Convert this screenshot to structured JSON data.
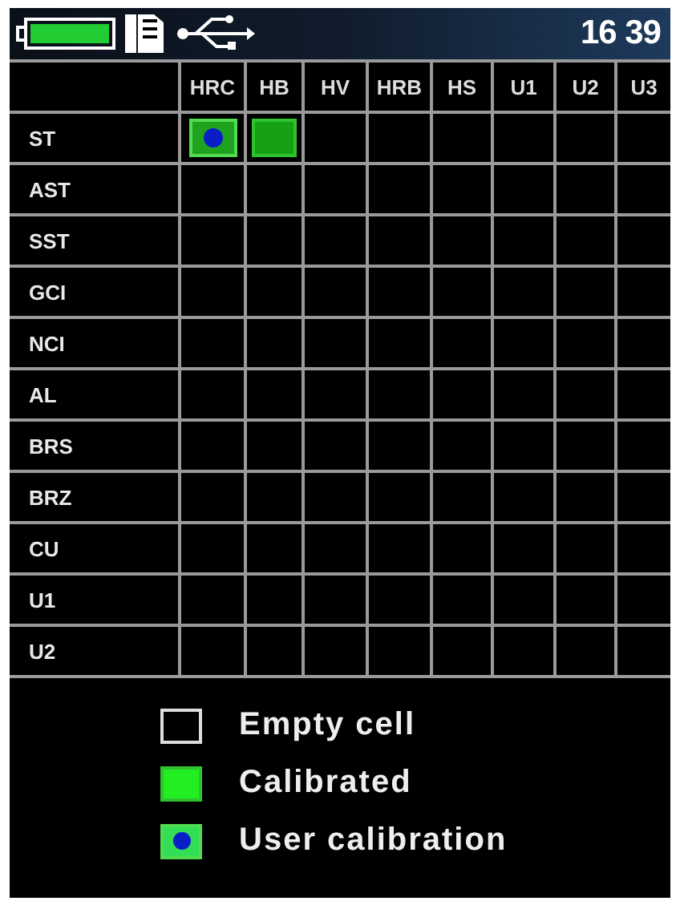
{
  "status_bar": {
    "time": "16 39"
  },
  "table": {
    "columns": [
      "HRC",
      "HB",
      "HV",
      "HRB",
      "HS",
      "U1",
      "U2",
      "U3"
    ],
    "rows": [
      {
        "label": "ST",
        "cells": [
          {
            "calibrated": true,
            "user_calibration": true
          },
          {
            "calibrated": true,
            "user_calibration": false
          },
          {
            "calibrated": false,
            "user_calibration": false
          },
          {
            "calibrated": false,
            "user_calibration": false
          },
          {
            "calibrated": false,
            "user_calibration": false
          },
          {
            "calibrated": false,
            "user_calibration": false
          },
          {
            "calibrated": false,
            "user_calibration": false
          },
          {
            "calibrated": false,
            "user_calibration": false
          }
        ]
      },
      {
        "label": "AST",
        "cells": [
          {
            "calibrated": false,
            "user_calibration": false
          },
          {
            "calibrated": false,
            "user_calibration": false
          },
          {
            "calibrated": false,
            "user_calibration": false
          },
          {
            "calibrated": false,
            "user_calibration": false
          },
          {
            "calibrated": false,
            "user_calibration": false
          },
          {
            "calibrated": false,
            "user_calibration": false
          },
          {
            "calibrated": false,
            "user_calibration": false
          },
          {
            "calibrated": false,
            "user_calibration": false
          }
        ]
      },
      {
        "label": "SST",
        "cells": [
          {
            "calibrated": false,
            "user_calibration": false
          },
          {
            "calibrated": false,
            "user_calibration": false
          },
          {
            "calibrated": false,
            "user_calibration": false
          },
          {
            "calibrated": false,
            "user_calibration": false
          },
          {
            "calibrated": false,
            "user_calibration": false
          },
          {
            "calibrated": false,
            "user_calibration": false
          },
          {
            "calibrated": false,
            "user_calibration": false
          },
          {
            "calibrated": false,
            "user_calibration": false
          }
        ]
      },
      {
        "label": "GCI",
        "cells": [
          {
            "calibrated": false,
            "user_calibration": false
          },
          {
            "calibrated": false,
            "user_calibration": false
          },
          {
            "calibrated": false,
            "user_calibration": false
          },
          {
            "calibrated": false,
            "user_calibration": false
          },
          {
            "calibrated": false,
            "user_calibration": false
          },
          {
            "calibrated": false,
            "user_calibration": false
          },
          {
            "calibrated": false,
            "user_calibration": false
          },
          {
            "calibrated": false,
            "user_calibration": false
          }
        ]
      },
      {
        "label": "NCI",
        "cells": [
          {
            "calibrated": false,
            "user_calibration": false
          },
          {
            "calibrated": false,
            "user_calibration": false
          },
          {
            "calibrated": false,
            "user_calibration": false
          },
          {
            "calibrated": false,
            "user_calibration": false
          },
          {
            "calibrated": false,
            "user_calibration": false
          },
          {
            "calibrated": false,
            "user_calibration": false
          },
          {
            "calibrated": false,
            "user_calibration": false
          },
          {
            "calibrated": false,
            "user_calibration": false
          }
        ]
      },
      {
        "label": "AL",
        "cells": [
          {
            "calibrated": false,
            "user_calibration": false
          },
          {
            "calibrated": false,
            "user_calibration": false
          },
          {
            "calibrated": false,
            "user_calibration": false
          },
          {
            "calibrated": false,
            "user_calibration": false
          },
          {
            "calibrated": false,
            "user_calibration": false
          },
          {
            "calibrated": false,
            "user_calibration": false
          },
          {
            "calibrated": false,
            "user_calibration": false
          },
          {
            "calibrated": false,
            "user_calibration": false
          }
        ]
      },
      {
        "label": "BRS",
        "cells": [
          {
            "calibrated": false,
            "user_calibration": false
          },
          {
            "calibrated": false,
            "user_calibration": false
          },
          {
            "calibrated": false,
            "user_calibration": false
          },
          {
            "calibrated": false,
            "user_calibration": false
          },
          {
            "calibrated": false,
            "user_calibration": false
          },
          {
            "calibrated": false,
            "user_calibration": false
          },
          {
            "calibrated": false,
            "user_calibration": false
          },
          {
            "calibrated": false,
            "user_calibration": false
          }
        ]
      },
      {
        "label": "BRZ",
        "cells": [
          {
            "calibrated": false,
            "user_calibration": false
          },
          {
            "calibrated": false,
            "user_calibration": false
          },
          {
            "calibrated": false,
            "user_calibration": false
          },
          {
            "calibrated": false,
            "user_calibration": false
          },
          {
            "calibrated": false,
            "user_calibration": false
          },
          {
            "calibrated": false,
            "user_calibration": false
          },
          {
            "calibrated": false,
            "user_calibration": false
          },
          {
            "calibrated": false,
            "user_calibration": false
          }
        ]
      },
      {
        "label": "CU",
        "cells": [
          {
            "calibrated": false,
            "user_calibration": false
          },
          {
            "calibrated": false,
            "user_calibration": false
          },
          {
            "calibrated": false,
            "user_calibration": false
          },
          {
            "calibrated": false,
            "user_calibration": false
          },
          {
            "calibrated": false,
            "user_calibration": false
          },
          {
            "calibrated": false,
            "user_calibration": false
          },
          {
            "calibrated": false,
            "user_calibration": false
          },
          {
            "calibrated": false,
            "user_calibration": false
          }
        ]
      },
      {
        "label": "U1",
        "cells": [
          {
            "calibrated": false,
            "user_calibration": false
          },
          {
            "calibrated": false,
            "user_calibration": false
          },
          {
            "calibrated": false,
            "user_calibration": false
          },
          {
            "calibrated": false,
            "user_calibration": false
          },
          {
            "calibrated": false,
            "user_calibration": false
          },
          {
            "calibrated": false,
            "user_calibration": false
          },
          {
            "calibrated": false,
            "user_calibration": false
          },
          {
            "calibrated": false,
            "user_calibration": false
          }
        ]
      },
      {
        "label": "U2",
        "cells": [
          {
            "calibrated": false,
            "user_calibration": false
          },
          {
            "calibrated": false,
            "user_calibration": false
          },
          {
            "calibrated": false,
            "user_calibration": false
          },
          {
            "calibrated": false,
            "user_calibration": false
          },
          {
            "calibrated": false,
            "user_calibration": false
          },
          {
            "calibrated": false,
            "user_calibration": false
          },
          {
            "calibrated": false,
            "user_calibration": false
          },
          {
            "calibrated": false,
            "user_calibration": false
          }
        ]
      }
    ]
  },
  "legend": [
    {
      "kind": "empty",
      "label": "Empty cell"
    },
    {
      "kind": "calibrated",
      "label": "Calibrated"
    },
    {
      "kind": "user",
      "label": "User calibration"
    }
  ]
}
